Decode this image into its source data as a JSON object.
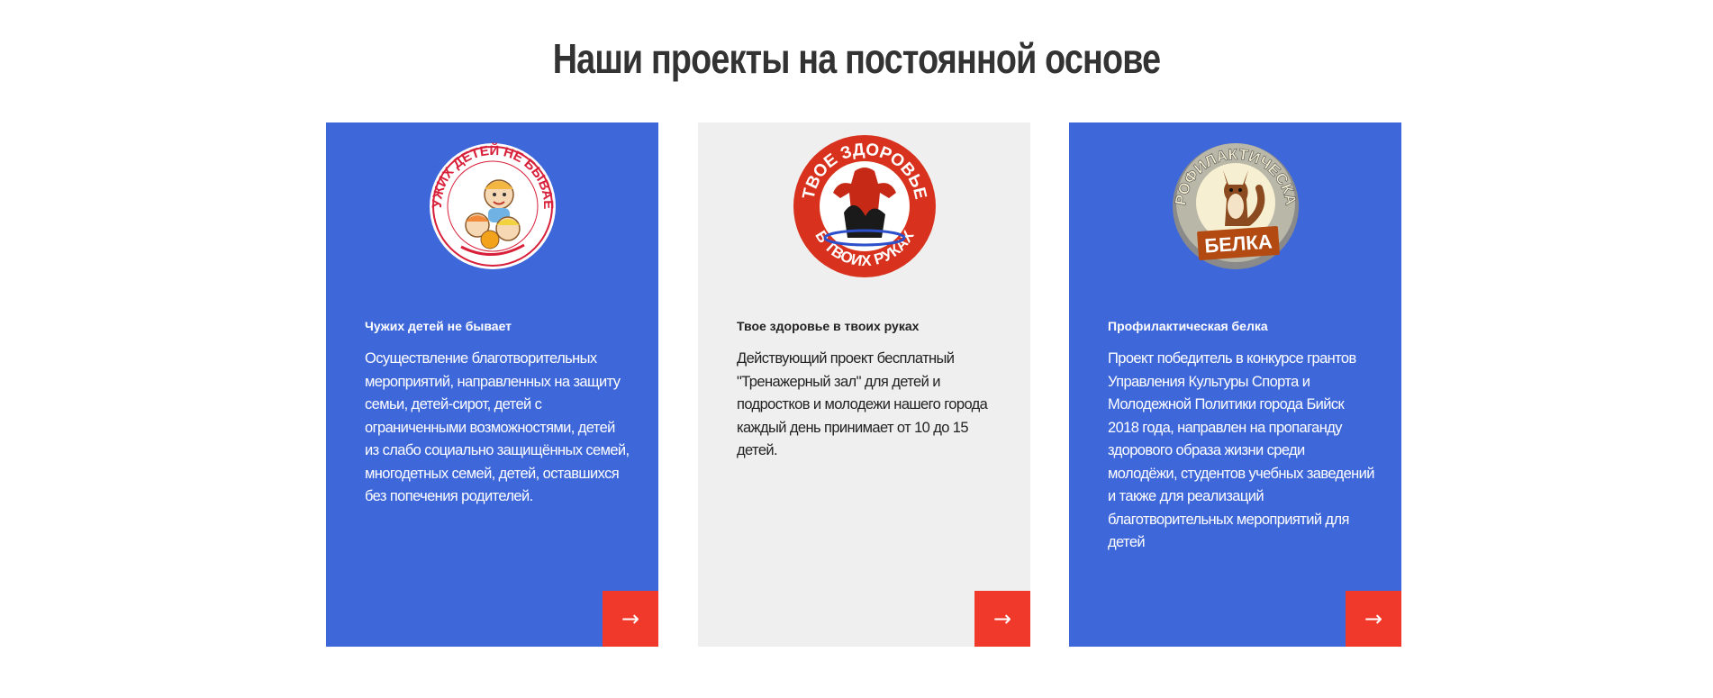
{
  "section": {
    "title": "Наши проекты на постоянной основе"
  },
  "cards": [
    {
      "title": "Чужих детей не бывает",
      "description": "Осуществление благотворительных мероприятий, направленных на защиту семьи, детей-сирот, детей с ограниченными возможностями, детей из слабо социально защищённых семей, многодетных семей, детей, оставшихся без попечения родителей.",
      "logo_text": "ЧУЖИХ ДЕТЕЙ НЕ БЫВАЕТ",
      "arrow": "→"
    },
    {
      "title": "Твое здоровье в твоих руках",
      "description": "Действующий проект бесплатный \"Тренажерный зал\" для детей и подростков и молодежи нашего города каждый день принимает от 10 до 15 детей.",
      "logo_text_top": "ТВОЕ ЗДОРОВЬЕ",
      "logo_text_bottom": "В ТВОИХ РУКАХ",
      "arrow": "→"
    },
    {
      "title": "Профилактическая белка",
      "description": "Проект победитель в конкурсе грантов Управления Культуры Спорта и Молодежной Политики города Бийск 2018 года, направлен на пропаганду здорового образа жизни среди молодёжи, студентов учебных заведений и также для реализаций благотворительных мероприятий для детей",
      "logo_text_top": "ПРОФИЛАКТИЧЕСКАЯ",
      "logo_text_bottom": "БЕЛКА",
      "arrow": "→"
    }
  ],
  "colors": {
    "blue_card": "#3e67d9",
    "grey_card": "#efefef",
    "arrow_button": "#f0392b",
    "title": "#333333"
  },
  "icons": [
    "arrow-right-icon"
  ]
}
